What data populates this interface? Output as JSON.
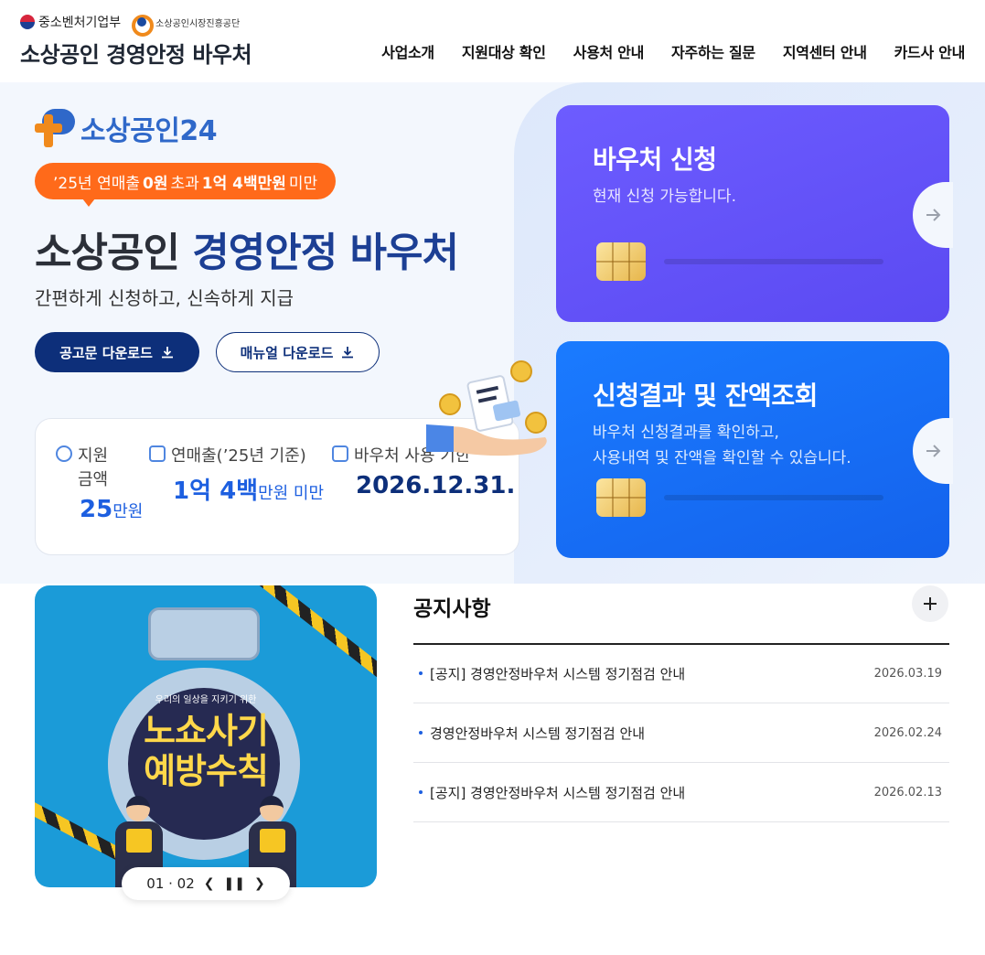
{
  "header": {
    "gov_ministry": "중소벤처기업부",
    "gov_agency": "소상공인시장진흥공단",
    "site_title": "소상공인 경영안정 바우처",
    "nav": [
      "사업소개",
      "지원대상 확인",
      "사용처 안내",
      "자주하는 질문",
      "지역센터 안내",
      "카드사 안내"
    ]
  },
  "hero": {
    "brand": "소상공인24",
    "pill": {
      "prefix": "’25년 연매출",
      "v1": "0원",
      "mid": "초과",
      "v2": "1억 4백만원",
      "suffix": "미만"
    },
    "title_plain": "소상공인 ",
    "title_blue": "경영안정 바우처",
    "subtitle": "간편하게 신청하고, 신속하게 지급",
    "btn_notice": "공고문 다운로드",
    "btn_manual": "매뉴얼 다운로드",
    "info": [
      {
        "label": "지원\n금액",
        "value": "25",
        "unit": "만원"
      },
      {
        "label": "연매출(’25년 기준)",
        "value": "1억 4백",
        "unit": "만원 미만"
      },
      {
        "label": "바우처 사용 기한",
        "value": "2026.12.31.",
        "unit": ""
      }
    ]
  },
  "cards": {
    "apply": {
      "title": "바우처 신청",
      "desc": "현재 신청 가능합니다."
    },
    "result": {
      "title": "신청결과 및 잔액조회",
      "desc": "바우처 신청결과를 확인하고,\n사용내역 및 잔액을 확인할 수 있습니다."
    }
  },
  "banner": {
    "small_text": "우리의 일상을 지키기 위한",
    "line1": "노쇼사기",
    "line2": "예방수칙",
    "pager": "01 · 02"
  },
  "notice": {
    "title": "공지사항",
    "items": [
      {
        "title": "[공지] 경영안정바우처 시스템 정기점검 안내",
        "date": "2026.03.19"
      },
      {
        "title": "경영안정바우처 시스템 정기점검 안내",
        "date": "2026.02.24"
      },
      {
        "title": "[공지] 경영안정바우처 시스템 정기점검 안내",
        "date": "2026.02.13"
      }
    ]
  },
  "colors": {
    "navy": "#0d2f7a",
    "accent_blue": "#1d5fe0",
    "orange": "#ff6a1a",
    "purple_card": "#6d5cff",
    "blue_card": "#1a7bff"
  }
}
